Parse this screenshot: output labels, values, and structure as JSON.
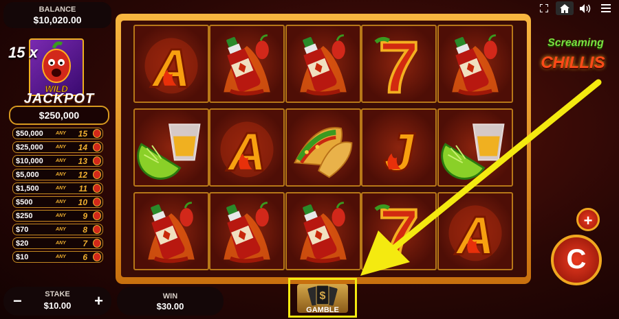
{
  "balance": {
    "label": "BALANCE",
    "value": "$10,020.00"
  },
  "top_icons": [
    "fullscreen-icon",
    "home-icon",
    "volume-icon",
    "menu-icon"
  ],
  "jackpot": {
    "multiplier": "15 x",
    "wild_label": "WILD",
    "title": "JACKPOT",
    "value": "$250,000",
    "paytable": [
      {
        "amount": "$50,000",
        "any": "ANY",
        "count": "15"
      },
      {
        "amount": "$25,000",
        "any": "ANY",
        "count": "14"
      },
      {
        "amount": "$10,000",
        "any": "ANY",
        "count": "13"
      },
      {
        "amount": "$5,000",
        "any": "ANY",
        "count": "12"
      },
      {
        "amount": "$1,500",
        "any": "ANY",
        "count": "11"
      },
      {
        "amount": "$500",
        "any": "ANY",
        "count": "10"
      },
      {
        "amount": "$250",
        "any": "ANY",
        "count": "9"
      },
      {
        "amount": "$70",
        "any": "ANY",
        "count": "8"
      },
      {
        "amount": "$20",
        "any": "ANY",
        "count": "7"
      },
      {
        "amount": "$10",
        "any": "ANY",
        "count": "6"
      }
    ]
  },
  "reels": [
    [
      "A",
      "hot-sauce",
      "hot-sauce",
      "seven",
      "hot-sauce"
    ],
    [
      "lime-shot",
      "A",
      "taco",
      "J",
      "lime-shot"
    ],
    [
      "hot-sauce",
      "hot-sauce",
      "hot-sauce",
      "seven",
      "A"
    ]
  ],
  "logo": {
    "line1": "Screaming",
    "line2": "CHILLIS"
  },
  "stake": {
    "label": "STAKE",
    "value": "$10.00",
    "minus": "−",
    "plus": "+"
  },
  "win": {
    "label": "WIN",
    "value": "$30.00"
  },
  "gamble": {
    "label": "GAMBLE",
    "symbol": "$"
  },
  "buttons": {
    "plus": "+",
    "spin": "C"
  },
  "colors": {
    "highlight": "#f4ea10",
    "gold": "#f0a820",
    "red": "#d2281a"
  }
}
